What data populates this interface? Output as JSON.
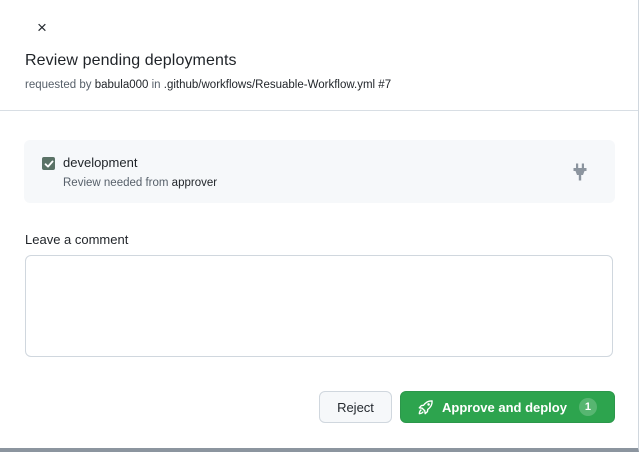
{
  "dialog": {
    "close_label": "×",
    "title": "Review pending deployments",
    "subtitle": {
      "prefix": "requested by ",
      "user": "babula000",
      "middle": " in ",
      "workflow": ".github/workflows/Resuable-Workflow.yml #7"
    }
  },
  "environment": {
    "name": "development",
    "checked": true,
    "review_prefix": "Review needed from ",
    "reviewer": "approver",
    "icon": "plug-icon"
  },
  "comment": {
    "label": "Leave a comment",
    "value": "",
    "placeholder": ""
  },
  "actions": {
    "reject_label": "Reject",
    "approve_label": "Approve and deploy",
    "approve_count": "1"
  },
  "colors": {
    "approve": "#2da44e",
    "checkbox": "#5a7266",
    "env_background": "#f6f8fa"
  }
}
